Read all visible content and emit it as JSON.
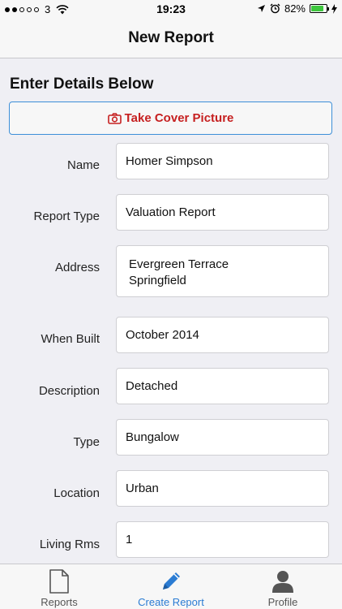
{
  "status_bar": {
    "carrier": "3",
    "time": "19:23",
    "battery": "82%",
    "battery_level": 0.82
  },
  "nav": {
    "title": "New Report"
  },
  "form": {
    "section_title": "Enter Details Below",
    "cover_button_label": "Take Cover Picture",
    "fields": {
      "name": {
        "label": "Name",
        "value": "Homer Simpson"
      },
      "report_type": {
        "label": "Report Type",
        "value": "Valuation Report"
      },
      "address": {
        "label": "Address",
        "line1": "Evergreen Terrace",
        "line2": "Springfield"
      },
      "when_built": {
        "label": "When Built",
        "value": "October 2014"
      },
      "description": {
        "label": "Description",
        "value": "Detached"
      },
      "type": {
        "label": "Type",
        "value": "Bungalow"
      },
      "location": {
        "label": "Location",
        "value": "Urban"
      },
      "living_rms": {
        "label": "Living Rms",
        "value": "1"
      }
    }
  },
  "tabs": [
    {
      "label": "Reports",
      "icon": "document-icon",
      "active": false
    },
    {
      "label": "Create Report",
      "icon": "pencil-icon",
      "active": true
    },
    {
      "label": "Profile",
      "icon": "person-icon",
      "active": false
    }
  ],
  "colors": {
    "accent": "#2b7cd3",
    "button_text": "#c62020",
    "button_border": "#3d8fd8",
    "battery": "#3ec73e"
  }
}
